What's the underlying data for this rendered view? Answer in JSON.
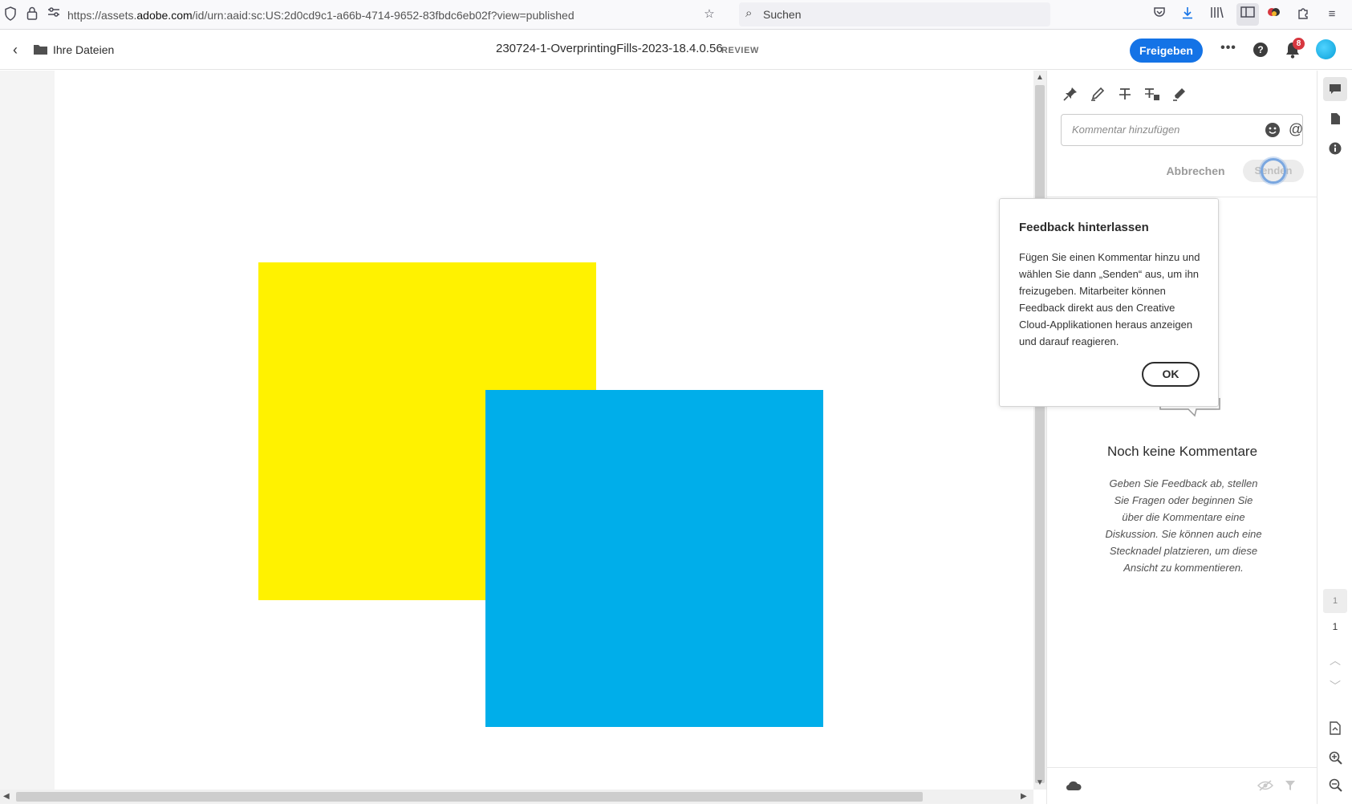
{
  "browser": {
    "url_prefix": "https://assets.",
    "url_domain": "adobe.com",
    "url_rest": "/id/urn:aaid:sc:US:2d0cd9c1-a66b-4714-9652-83fbdc6eb02f?view=published",
    "search_placeholder": "Suchen"
  },
  "header": {
    "back_label": "Ihre Dateien",
    "title": "230724-1-OverprintingFills-2023-18.4.0.56",
    "badge": "REVIEW",
    "share_label": "Freigeben",
    "notification_count": "8",
    "accent_color": "#1473e6"
  },
  "canvas": {
    "shapes": [
      {
        "name": "yellow-square",
        "color": "#fff200"
      },
      {
        "name": "cyan-square",
        "color": "#00aeea"
      }
    ]
  },
  "comments": {
    "tools": [
      "pin-icon",
      "pencil-icon",
      "strikethrough-icon",
      "replace-text-icon",
      "highlighter-icon"
    ],
    "input_placeholder": "Kommentar hinzufügen",
    "cancel_label": "Abbrechen",
    "send_label": "Senden",
    "empty_title": "Noch keine Kommentare",
    "empty_description": "Geben Sie Feedback ab, stellen Sie Fragen oder beginnen Sie über die Kommentare eine Diskussion. Sie können auch eine Stecknadel platzieren, um diese Ansicht zu kommentieren."
  },
  "popover": {
    "title": "Feedback hinterlassen",
    "body": "Fügen Sie einen Kommentar hinzu und wählen Sie dann „Senden“ aus, um ihn freizugeben. Mitarbeiter können Feedback direkt aus den Creative Cloud-Applikationen heraus anzeigen und darauf reagieren.",
    "ok_label": "OK"
  },
  "rail": {
    "current_page": "1",
    "total_pages": "1"
  }
}
